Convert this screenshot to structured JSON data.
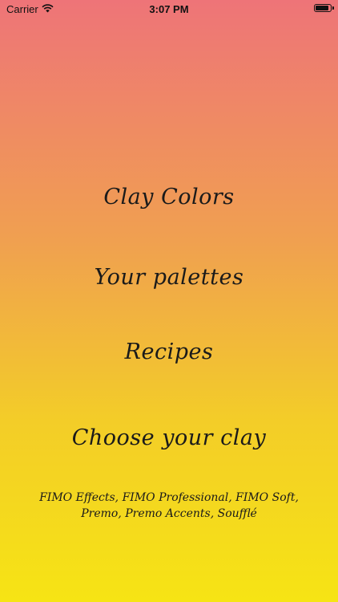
{
  "status_bar": {
    "carrier": "Carrier",
    "time": "3:07 PM",
    "battery_level": 0.95
  },
  "menu": {
    "clay_colors": "Clay Colors",
    "your_palettes": "Your palettes",
    "recipes": "Recipes",
    "choose_clay": "Choose your clay"
  },
  "clay_list": {
    "line1": "FIMO Effects, FIMO Professional, FIMO Soft,",
    "line2": "Premo, Premo Accents, Soufflé"
  },
  "colors": {
    "gradient_top": "#ee7478",
    "gradient_bottom": "#f6e414",
    "text": "#1a1a1a"
  }
}
